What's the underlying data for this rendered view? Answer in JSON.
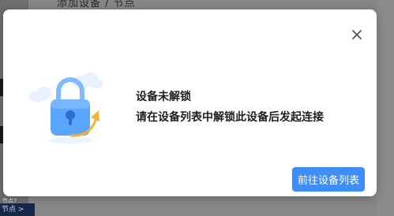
{
  "background": {
    "page_title": "添加设备 / 节点",
    "bottom_note": "节点7",
    "bottom_link": "节点 >"
  },
  "dialog": {
    "title": "设备未解锁",
    "message": "请在设备列表中解锁此设备后发起连接",
    "primary_button": "前往设备列表",
    "close_icon": "close-icon",
    "illustration_icon": "padlock-icon"
  },
  "colors": {
    "primary": "#3f8ef7",
    "lock": "#5aa6ff",
    "arrow": "#f2b233"
  }
}
